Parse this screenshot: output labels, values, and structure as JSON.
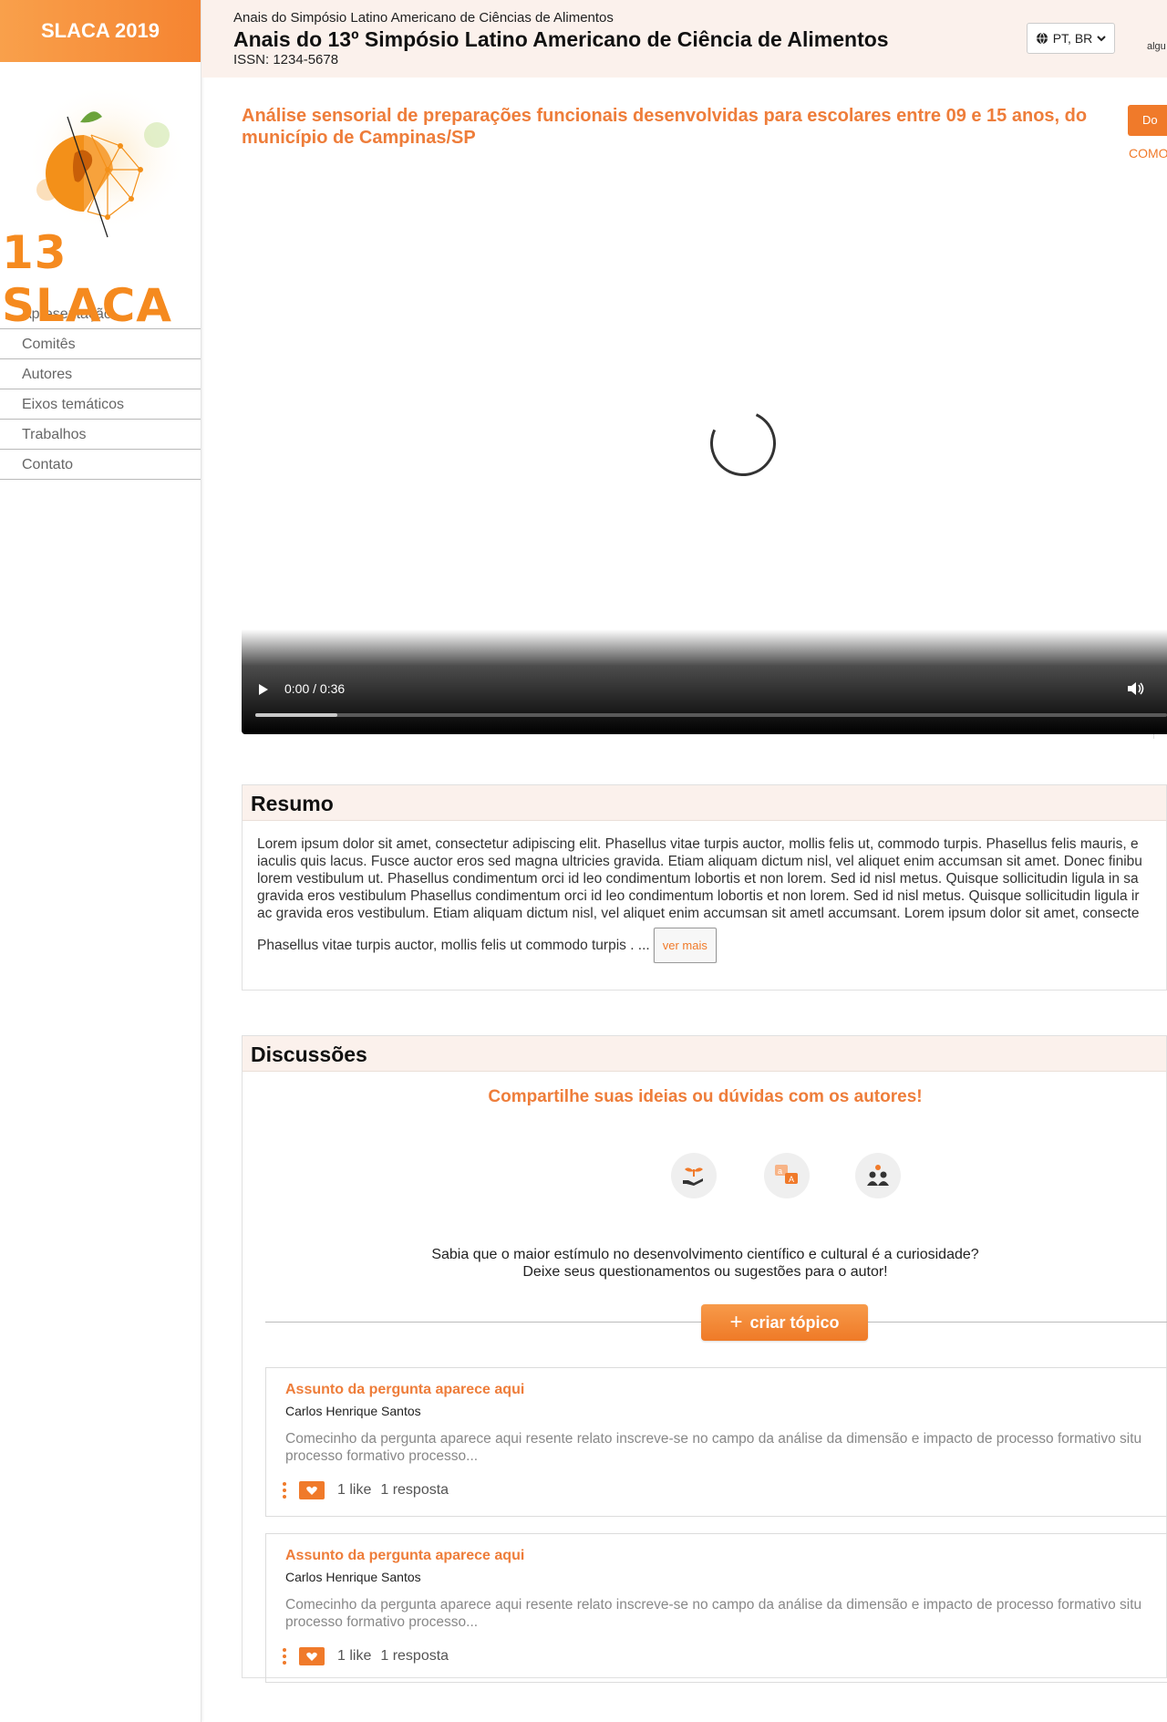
{
  "sidebar": {
    "brand": "SLACA 2019",
    "logo_text": "13 SLACA",
    "nav": [
      "Apresentação",
      "Comitês",
      "Autores",
      "Eixos temáticos",
      "Trabalhos",
      "Contato"
    ]
  },
  "header": {
    "subtitle": "Anais do Simpósio Latino Americano de Ciências de Alimentos",
    "title": "Anais do 13º Simpósio Latino Americano de Ciência de Alimentos",
    "issn": "ISSN: 1234-5678",
    "language": "PT, BR",
    "right_text": "algu"
  },
  "paper": {
    "title": "Análise sensorial de preparações funcionais desenvolvidas para escolares entre 09 e 15 anos, do município de Campinas/SP",
    "download_label": "Do",
    "como_label": "COMO",
    "video": {
      "time": "0:00 / 0:36",
      "buffered_fraction": 0.09
    }
  },
  "resumo": {
    "heading": "Resumo",
    "lines": [
      "Lorem ipsum dolor sit amet, consectetur adipiscing elit. Phasellus vitae turpis auctor, mollis felis ut, commodo turpis. Phasellus felis mauris, e",
      "iaculis quis lacus. Fusce auctor eros sed magna ultricies gravida. Etiam aliquam dictum nisl, vel aliquet enim accumsan sit amet. Donec finibu",
      "lorem vestibulum ut. Phasellus condimentum orci id leo condimentum lobortis et non lorem. Sed id nisl metus. Quisque sollicitudin ligula in sa",
      "gravida eros vestibulum Phasellus condimentum orci id leo condimentum lobortis et non lorem. Sed id nisl metus. Quisque sollicitudin ligula ir",
      "ac gravida eros vestibulum. Etiam aliquam dictum nisl, vel aliquet enim accumsan sit ametl accumsant. Lorem ipsum dolor sit amet, consecte"
    ],
    "last_line": "Phasellus vitae turpis auctor, mollis felis ut commodo turpis . ...",
    "ver_mais": "ver mais"
  },
  "discussoes": {
    "heading": "Discussões",
    "callout": "Compartilhe suas ideias ou dúvidas com os autores!",
    "icons": [
      "plant-hand-icon",
      "chat-translate-icon",
      "people-icon"
    ],
    "text_line1": "Sabia que o maior estímulo no desenvolvimento científico e cultural é a curiosidade?",
    "text_line2": "Deixe seus questionamentos ou sugestões para o autor!",
    "create_label": "criar tópico",
    "topics": [
      {
        "title": "Assunto da pergunta aparece aqui",
        "author": "Carlos Henrique Santos",
        "excerpt_line1": "Comecinho da pergunta aparece aqui resente relato inscreve-se no campo da análise da dimensão e impacto de processo formativo situ",
        "excerpt_line2": "processo formativo processo...",
        "likes": "1 like",
        "replies": "1 resposta"
      },
      {
        "title": "Assunto da pergunta aparece aqui",
        "author": "Carlos Henrique Santos",
        "excerpt_line1": "Comecinho da pergunta aparece aqui resente relato inscreve-se no campo da análise da dimensão e impacto de processo formativo situ",
        "excerpt_line2": "processo formativo processo...",
        "likes": "1 like",
        "replies": "1 resposta"
      }
    ]
  },
  "colors": {
    "accent": "#f07a2a",
    "header_bg": "#fbf1ec"
  }
}
